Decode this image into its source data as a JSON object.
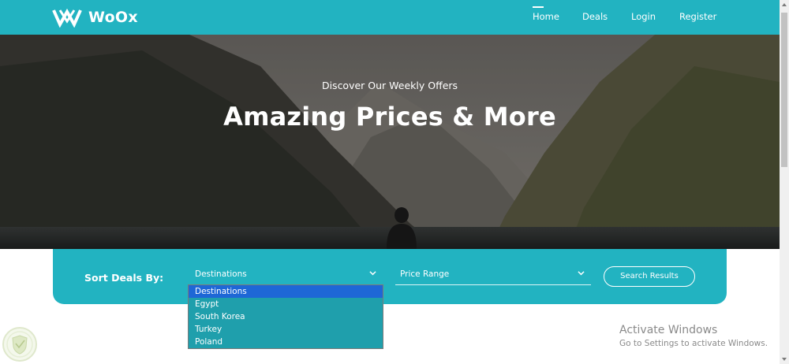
{
  "brand": {
    "name": "WoOx",
    "logo_icon": "woox-logo-icon"
  },
  "nav": {
    "home": "Home",
    "deals": "Deals",
    "login": "Login",
    "register": "Register"
  },
  "hero": {
    "subtitle": "Discover Our Weekly Offers",
    "title": "Amazing Prices & More"
  },
  "filter": {
    "label": "Sort Deals By:",
    "destinations": {
      "value": "Destinations",
      "icon": "chevron-down-icon"
    },
    "price": {
      "value": "Price Range",
      "icon": "chevron-down-icon"
    },
    "search_button": "Search Results"
  },
  "dropdown": {
    "options": [
      "Destinations",
      "Egypt",
      "South Korea",
      "Turkey",
      "Poland"
    ],
    "selected": "Destinations"
  },
  "windows_watermark": {
    "title": "Activate Windows",
    "subtitle": "Go to Settings to activate Windows."
  },
  "colors": {
    "primary": "#22b3c1",
    "dropdown_bg": "#1f9fac",
    "selected_option": "#1e67d6"
  }
}
